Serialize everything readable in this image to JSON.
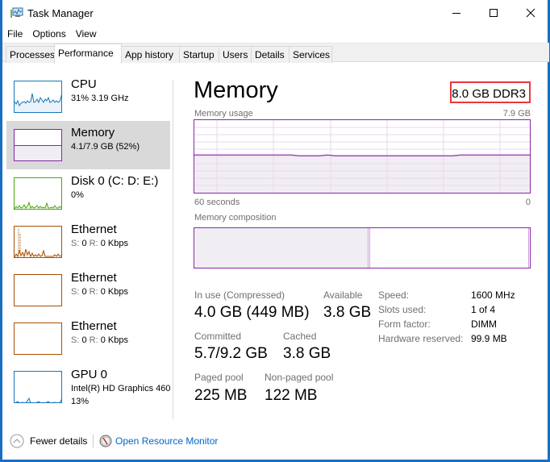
{
  "window": {
    "title": "Task Manager",
    "controls": {
      "minimize": "minimize",
      "maximize": "maximize",
      "close": "close"
    }
  },
  "menu": [
    "File",
    "Options",
    "View"
  ],
  "tabs": [
    {
      "label": "Processes",
      "active": false
    },
    {
      "label": "Performance",
      "active": true
    },
    {
      "label": "App history",
      "active": false
    },
    {
      "label": "Startup",
      "active": false
    },
    {
      "label": "Users",
      "active": false
    },
    {
      "label": "Details",
      "active": false
    },
    {
      "label": "Services",
      "active": false
    }
  ],
  "sidebar": {
    "items": [
      {
        "title": "CPU",
        "sub": "31% 3.19 GHz",
        "color": "#1779ba",
        "selected": false
      },
      {
        "title": "Memory",
        "sub": "4.1/7.9 GB (52%)",
        "color": "#8b24a8",
        "selected": true
      },
      {
        "title": "Disk 0 (C: D: E:)",
        "sub": "0%",
        "color": "#4da60c",
        "selected": false
      },
      {
        "title": "Ethernet",
        "sub_s_label": "S:",
        "sub_s_value": "0",
        "sub_r_label": "R:",
        "sub_r_value": "0 Kbps",
        "color": "#a74f01",
        "selected": false
      },
      {
        "title": "Ethernet",
        "sub_s_label": "S:",
        "sub_s_value": "0",
        "sub_r_label": "R:",
        "sub_r_value": "0 Kbps",
        "color": "#a74f01",
        "selected": false
      },
      {
        "title": "Ethernet",
        "sub_s_label": "S:",
        "sub_s_value": "0",
        "sub_r_label": "R:",
        "sub_r_value": "0 Kbps",
        "color": "#a74f01",
        "selected": false
      },
      {
        "title": "GPU 0",
        "sub": "Intel(R) HD Graphics 460",
        "sub2": "13%",
        "color": "#1779ba",
        "selected": false
      }
    ]
  },
  "main": {
    "title": "Memory",
    "spec": "8.0 GB DDR3",
    "usage_label": "Memory usage",
    "usage_max": "7.9 GB",
    "usage_fraction": 0.52,
    "time_left": "60 seconds",
    "time_right": "0",
    "composition_label": "Memory composition",
    "composition_in_use_fraction": 0.52,
    "stats": {
      "in_use_label": "In use (Compressed)",
      "in_use_value": "4.0 GB (449 MB)",
      "available_label": "Available",
      "available_value": "3.8 GB",
      "committed_label": "Committed",
      "committed_value": "5.7/9.2 GB",
      "cached_label": "Cached",
      "cached_value": "3.8 GB",
      "paged_label": "Paged pool",
      "paged_value": "225 MB",
      "nonpaged_label": "Non-paged pool",
      "nonpaged_value": "122 MB"
    },
    "specs": [
      {
        "key": "Speed:",
        "value": "1600 MHz"
      },
      {
        "key": "Slots used:",
        "value": "1 of 4"
      },
      {
        "key": "Form factor:",
        "value": "DIMM"
      },
      {
        "key": "Hardware reserved:",
        "value": "99.9 MB"
      }
    ]
  },
  "footer": {
    "fewer_details": "Fewer details",
    "open_resmon": "Open Resource Monitor"
  },
  "colors": {
    "memory_accent": "#8b24a8",
    "highlight_box": "#e8373d",
    "link": "#0066cc"
  }
}
